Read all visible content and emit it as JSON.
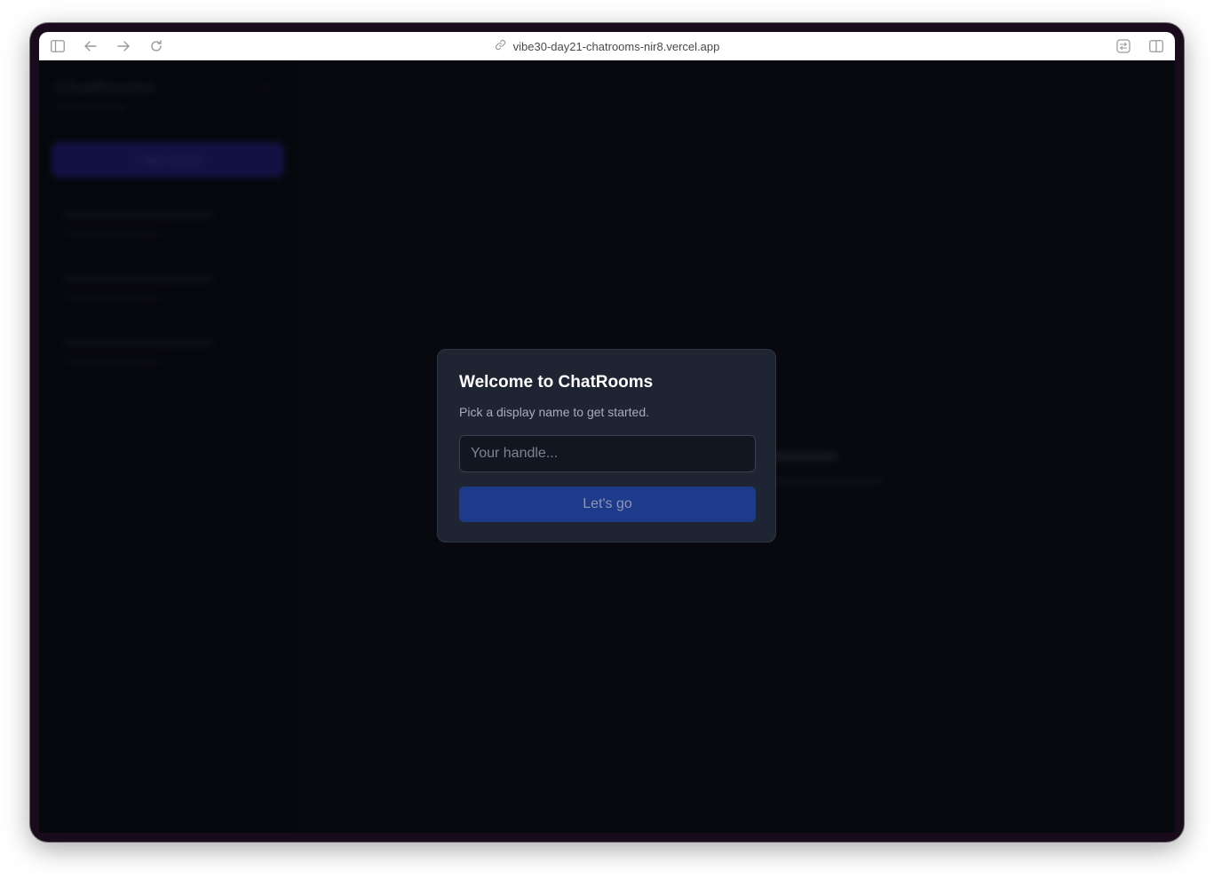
{
  "browser": {
    "url": "vibe30-day21-chatrooms-nir8.vercel.app",
    "icons": {
      "sidebar_toggle": "sidebar-icon",
      "back": "arrow-left-icon",
      "forward": "arrow-right-icon",
      "reload": "reload-icon",
      "link": "link-icon",
      "translate": "translate-icon",
      "split_view": "split-view-icon"
    }
  },
  "sidebar": {
    "title": "ChatRooms",
    "new_room_label": "+ New Room"
  },
  "modal": {
    "title": "Welcome to ChatRooms",
    "description": "Pick a display name to get started.",
    "input_placeholder": "Your handle...",
    "input_value": "",
    "button_label": "Let's go"
  },
  "colors": {
    "modal_bg": "#1e2431",
    "button_bg": "#1e3a8a",
    "page_bg": "#0a0c12",
    "sidebar_accent": "#2a22a8"
  }
}
